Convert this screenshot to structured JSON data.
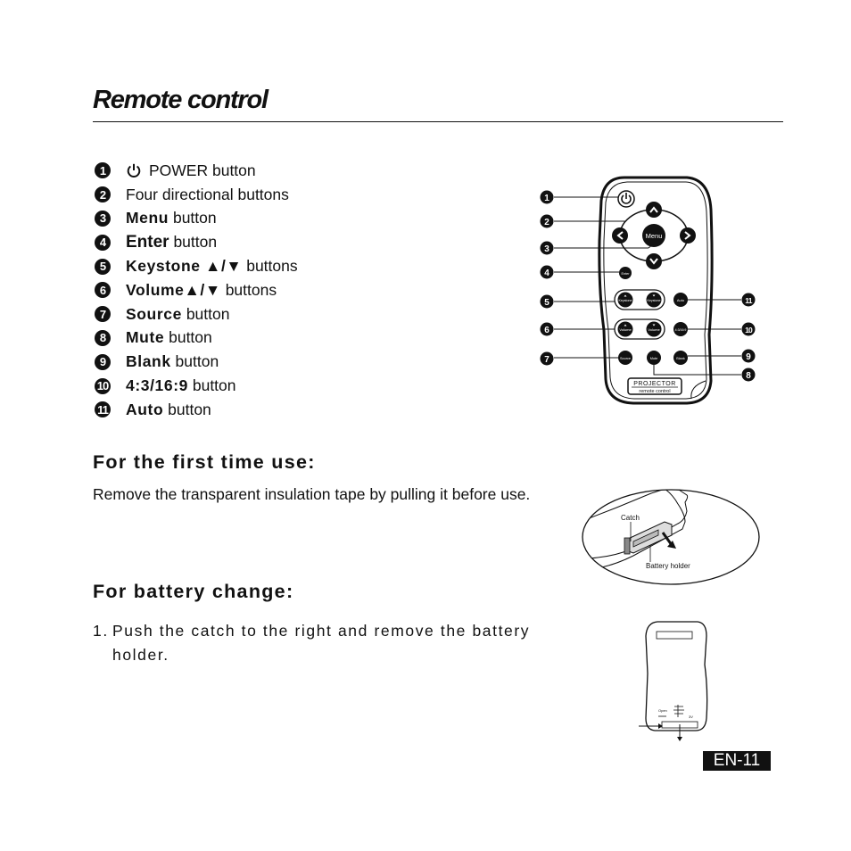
{
  "page": {
    "title": "Remote control",
    "page_number": "EN-11"
  },
  "legend": [
    {
      "num": "1",
      "icon": "power-icon",
      "bold": "",
      "text": "POWER button"
    },
    {
      "num": "2",
      "bold": "",
      "text": "Four directional buttons"
    },
    {
      "num": "3",
      "bold": "Menu",
      "text": " button"
    },
    {
      "num": "4",
      "bold": "Enter",
      "text": " button"
    },
    {
      "num": "5",
      "bold": "Keystone ▲/▼",
      "text": " buttons"
    },
    {
      "num": "6",
      "bold": "Volume▲/▼",
      "text": " buttons"
    },
    {
      "num": "7",
      "bold": "Source",
      "text": " button"
    },
    {
      "num": "8",
      "bold": "Mute",
      "text": " button"
    },
    {
      "num": "9",
      "bold": "Blank",
      "text": " button"
    },
    {
      "num": "10",
      "bold": "4:3/16:9",
      "text": " button"
    },
    {
      "num": "11",
      "bold": "Auto",
      "text": " button"
    }
  ],
  "remote_diagram": {
    "callouts": [
      "1",
      "2",
      "3",
      "4",
      "5",
      "6",
      "7",
      "8",
      "9",
      "10",
      "11"
    ],
    "button_labels": {
      "menu": "Menu",
      "enter": "Enter",
      "keystone_up": "Keystone",
      "keystone_down": "Keystone",
      "volume_up": "Volume",
      "volume_down": "Volume",
      "auto": "Auto",
      "aspect": "4:3/16:9",
      "source": "Source",
      "mute": "Mute",
      "blank": "Blank"
    },
    "brand_line1": "PROJECTOR",
    "brand_line2": "remote control"
  },
  "first_use": {
    "heading": "For the first time use:",
    "body": "Remove the transparent insulation tape by pulling it before use.",
    "figure_labels": {
      "catch": "Catch",
      "battery_holder": "Battery holder"
    }
  },
  "battery_change": {
    "heading": "For battery change:",
    "steps": [
      {
        "num": "1.",
        "first": "Push the catch to the right and remove the battery",
        "rest": "holder."
      }
    ],
    "figure_labels": {
      "open": "Open",
      "voltage": "3V"
    }
  }
}
